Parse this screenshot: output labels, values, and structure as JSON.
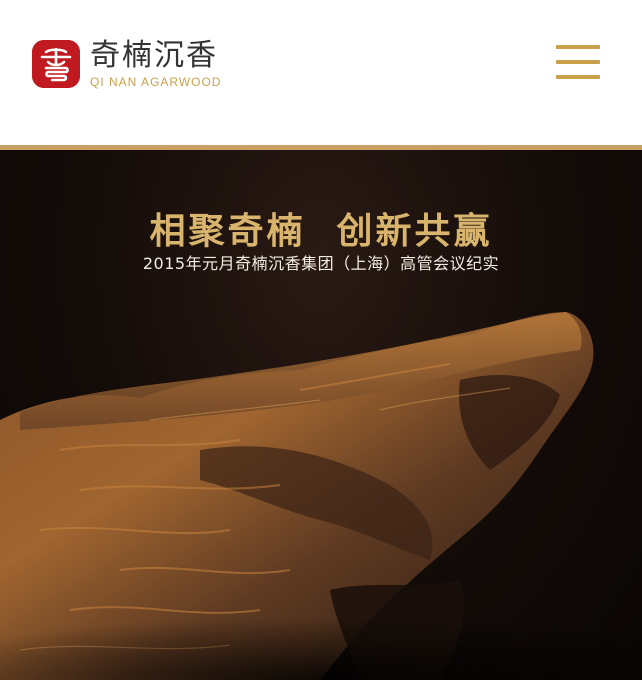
{
  "brand": {
    "name_cn": "奇楠沉香",
    "name_en": "QI NAN AGARWOOD",
    "logo_icon": "agarwood-seal-logo-icon",
    "primary_color": "#c0191f",
    "accent_color": "#c9a14a"
  },
  "header": {
    "menu_icon": "hamburger-menu-icon"
  },
  "hero": {
    "title": "相聚奇楠  创新共赢",
    "subtitle": "2015年元月奇楠沉香集团（上海）高管会议纪实",
    "image_subject": "agarwood-piece-image",
    "title_color": "#d8b46c"
  }
}
